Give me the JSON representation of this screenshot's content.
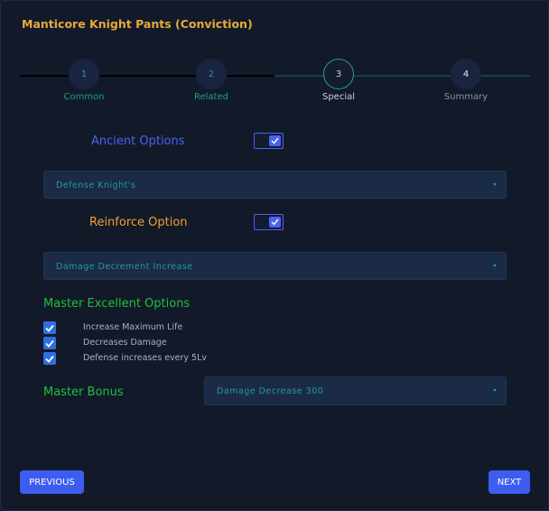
{
  "title": "Manticore Knight Pants (Conviction)",
  "stepper": {
    "steps": [
      {
        "number": "1",
        "label": "Common"
      },
      {
        "number": "2",
        "label": "Related"
      },
      {
        "number": "3",
        "label": "Special"
      },
      {
        "number": "4",
        "label": "Summary"
      }
    ],
    "current_step": 3
  },
  "ancient": {
    "label": "Ancient Options",
    "enabled": true,
    "selected": "Defense Knight's"
  },
  "reinforce": {
    "label": "Reinforce Option",
    "enabled": true,
    "selected": "Damage Decrement Increase"
  },
  "master_excellent": {
    "label": "Master Excellent Options",
    "options": [
      {
        "label": "Increase Maximum Life",
        "checked": true
      },
      {
        "label": "Decreases Damage",
        "checked": true
      },
      {
        "label": "Defense increases every 5Lv",
        "checked": true
      }
    ]
  },
  "master_bonus": {
    "label": "Master Bonus",
    "selected": "Damage Decrease 300"
  },
  "buttons": {
    "previous": "PREVIOUS",
    "next": "NEXT"
  },
  "colors": {
    "accent": "#3d5df0",
    "title": "#e8a93a",
    "ancient_label": "#4a63f0",
    "reinforce_label": "#f0a030",
    "master_label": "#1fbf3a",
    "select_text": "#1f9d8d"
  }
}
